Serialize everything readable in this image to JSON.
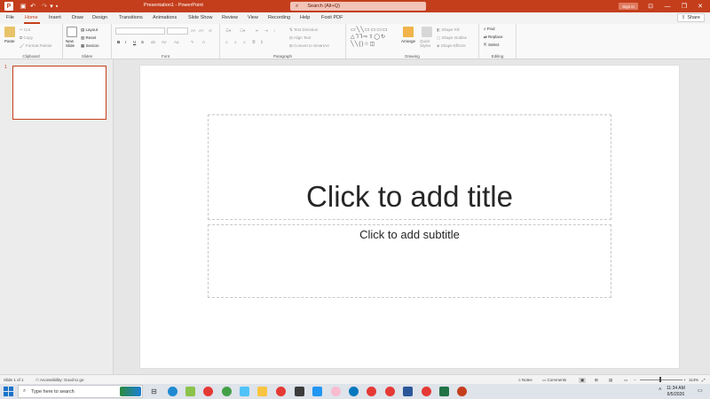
{
  "titlebar": {
    "app_icon": "powerpoint-icon",
    "document_title": "Presentation1 - PowerPoint",
    "search_placeholder": "Search (Alt+Q)",
    "signin_label": "Sign in",
    "colors": {
      "accent": "#c43e1c"
    }
  },
  "tabs": [
    "File",
    "Home",
    "Insert",
    "Draw",
    "Design",
    "Transitions",
    "Animations",
    "Slide Show",
    "Review",
    "View",
    "Recording",
    "Help",
    "Foxit PDF"
  ],
  "active_tab": "Home",
  "share_label": "Share",
  "ribbon": {
    "clipboard": {
      "label": "Clipboard",
      "paste": "Paste",
      "cut": "Cut",
      "copy": "Copy",
      "format_painter": "Format Painter"
    },
    "slides": {
      "label": "Slides",
      "new_slide": "New Slide",
      "layout": "Layout",
      "reset": "Reset",
      "section": "Section"
    },
    "font": {
      "label": "Font",
      "bold": "B",
      "italic": "I",
      "underline": "U",
      "strike": "S"
    },
    "paragraph": {
      "label": "Paragraph",
      "text_direction": "Text Direction",
      "align_text": "Align Text",
      "convert_smartart": "Convert to SmartArt"
    },
    "drawing": {
      "label": "Drawing",
      "arrange": "Arrange",
      "quick_styles": "Quick Styles",
      "shape_fill": "Shape Fill",
      "shape_outline": "Shape Outline",
      "shape_effects": "Shape Effects"
    },
    "editing": {
      "label": "Editing",
      "find": "Find",
      "replace": "Replace",
      "select": "Select"
    }
  },
  "thumbnails": {
    "slide_number": "1"
  },
  "slide": {
    "title_placeholder": "Click to add title",
    "subtitle_placeholder": "Click to add subtitle"
  },
  "statusbar": {
    "slide_info": "Slide 1 of 1",
    "accessibility": "Accessibility: Good to go",
    "notes": "Notes",
    "comments": "Comments",
    "zoom": "114%"
  },
  "taskbar": {
    "search_placeholder": "Type here to search",
    "time": "11:34 AM",
    "date": "6/5/2026"
  }
}
